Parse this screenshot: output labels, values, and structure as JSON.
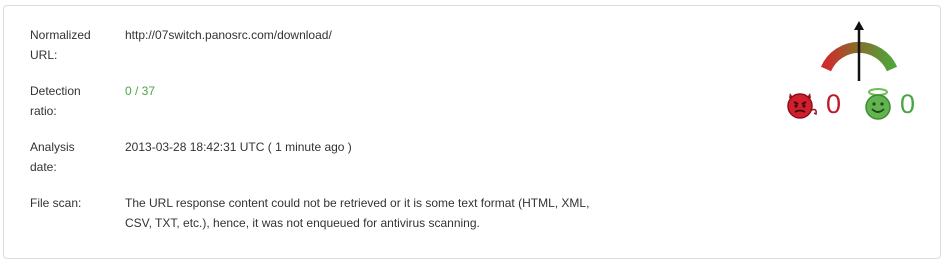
{
  "details": {
    "normalized_url_label_line1": "Normalized",
    "normalized_url_label_line2": "URL:",
    "normalized_url_value": "http://07switch.panosrc.com/download/",
    "detection_label_line1": "Detection",
    "detection_label_line2": "ratio:",
    "detection_value": "0 / 37",
    "analysis_label_line1": "Analysis",
    "analysis_label_line2": "date:",
    "analysis_value": "2013-03-28 18:42:31 UTC ( 1 minute ago )",
    "file_scan_label": "File scan:",
    "file_scan_value_line1": "The URL response content could not be retrieved or it is some text format (HTML, XML,",
    "file_scan_value_line2": "CSV, TXT, etc.), hence, it was not enqueued for antivirus scanning."
  },
  "community": {
    "malicious_votes": "0",
    "harmless_votes": "0",
    "gauge_position": 0.5,
    "colors": {
      "bad": "#c0192b",
      "good": "#4aa544",
      "neutral": "#444444"
    }
  }
}
